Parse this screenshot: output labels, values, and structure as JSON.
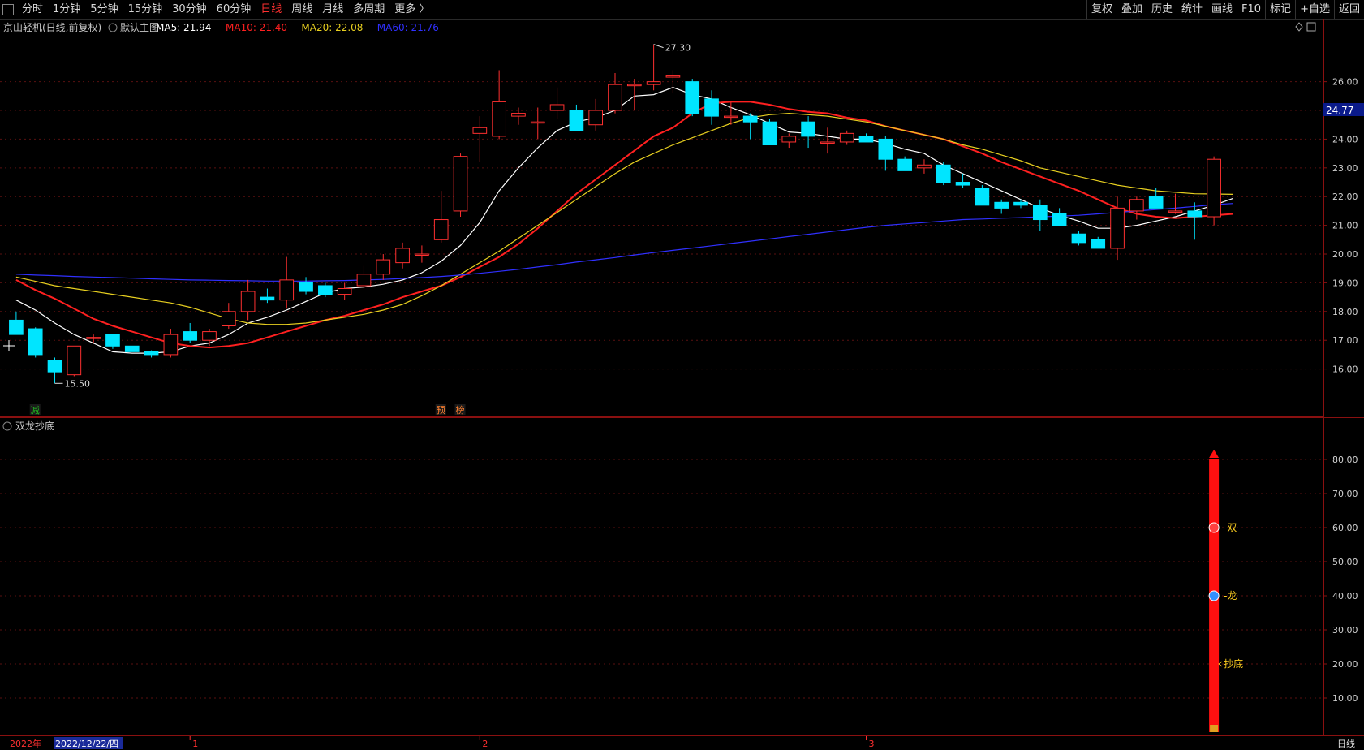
{
  "toolbar": {
    "periods": [
      "分时",
      "1分钟",
      "5分钟",
      "15分钟",
      "30分钟",
      "60分钟",
      "日线",
      "周线",
      "月线",
      "多周期",
      "更多 〉"
    ],
    "active_period": "日线",
    "tools": [
      "复权",
      "叠加",
      "历史",
      "统计",
      "画线",
      "F10",
      "标记",
      "+自选",
      "返回"
    ]
  },
  "main": {
    "stock_title": "京山轻机(日线,前复权)",
    "template_label": "默认主图",
    "ma": [
      {
        "label": "MA5: 21.94",
        "color": "#ffffff"
      },
      {
        "label": "MA10: 21.40",
        "color": "#ff2020"
      },
      {
        "label": "MA20: 22.08",
        "color": "#e8d020"
      },
      {
        "label": "MA60: 21.76",
        "color": "#3030ff"
      }
    ],
    "price_tag": "24.77",
    "high_label": "27.30",
    "low_label": "15.50",
    "markers": [
      {
        "text": "减",
        "color": "#20c020",
        "index": 1
      },
      {
        "text": "预",
        "color": "#ff8030",
        "index": 22
      },
      {
        "text": "榜",
        "color": "#ff8030",
        "index": 23
      }
    ]
  },
  "indicator": {
    "title": "双龙抄底",
    "labels": [
      {
        "text": "-双",
        "value": 60
      },
      {
        "text": "-龙",
        "value": 40
      },
      {
        "text": "抄底",
        "value": 20
      }
    ]
  },
  "axis": {
    "year_label": "2022年",
    "cursor_date": "2022/12/22/四",
    "months": [
      {
        "text": "1",
        "index": 9
      },
      {
        "text": "2",
        "index": 24
      },
      {
        "text": "3",
        "index": 44
      }
    ],
    "period_label": "日线"
  },
  "chart_data": {
    "type": "candlestick",
    "title": "京山轻机(日线,前复权)",
    "y_ticks": [
      16.0,
      17.0,
      18.0,
      19.0,
      20.0,
      21.0,
      22.0,
      23.0,
      24.0,
      25.0,
      26.0
    ],
    "ylim": [
      15.0,
      27.6
    ],
    "candles": [
      {
        "o": 17.7,
        "h": 18.0,
        "l": 17.2,
        "c": 17.2
      },
      {
        "o": 17.4,
        "h": 17.45,
        "l": 16.4,
        "c": 16.5
      },
      {
        "o": 16.3,
        "h": 16.4,
        "l": 15.5,
        "c": 15.9
      },
      {
        "o": 15.8,
        "h": 16.8,
        "l": 15.75,
        "c": 16.8
      },
      {
        "o": 17.1,
        "h": 17.2,
        "l": 16.9,
        "c": 17.1
      },
      {
        "o": 17.2,
        "h": 17.2,
        "l": 16.7,
        "c": 16.8
      },
      {
        "o": 16.8,
        "h": 16.8,
        "l": 16.6,
        "c": 16.6
      },
      {
        "o": 16.6,
        "h": 16.65,
        "l": 16.4,
        "c": 16.5
      },
      {
        "o": 16.5,
        "h": 17.4,
        "l": 16.4,
        "c": 17.2
      },
      {
        "o": 17.3,
        "h": 17.6,
        "l": 16.9,
        "c": 17.0
      },
      {
        "o": 17.0,
        "h": 17.4,
        "l": 16.8,
        "c": 17.3
      },
      {
        "o": 17.5,
        "h": 18.3,
        "l": 17.4,
        "c": 18.0
      },
      {
        "o": 18.0,
        "h": 19.1,
        "l": 17.7,
        "c": 18.7
      },
      {
        "o": 18.5,
        "h": 18.8,
        "l": 18.3,
        "c": 18.4
      },
      {
        "o": 18.4,
        "h": 19.9,
        "l": 18.1,
        "c": 19.1
      },
      {
        "o": 19.0,
        "h": 19.2,
        "l": 18.6,
        "c": 18.7
      },
      {
        "o": 18.9,
        "h": 19.0,
        "l": 18.5,
        "c": 18.6
      },
      {
        "o": 18.6,
        "h": 19.0,
        "l": 18.4,
        "c": 18.8
      },
      {
        "o": 18.9,
        "h": 19.6,
        "l": 18.8,
        "c": 19.3
      },
      {
        "o": 19.3,
        "h": 20.0,
        "l": 19.1,
        "c": 19.8
      },
      {
        "o": 19.7,
        "h": 20.4,
        "l": 19.5,
        "c": 20.2
      },
      {
        "o": 20.0,
        "h": 20.3,
        "l": 19.7,
        "c": 20.0
      },
      {
        "o": 20.5,
        "h": 22.2,
        "l": 20.4,
        "c": 21.2
      },
      {
        "o": 21.5,
        "h": 23.5,
        "l": 21.3,
        "c": 23.4
      },
      {
        "o": 24.2,
        "h": 24.8,
        "l": 23.2,
        "c": 24.4
      },
      {
        "o": 24.1,
        "h": 26.4,
        "l": 24.0,
        "c": 25.3
      },
      {
        "o": 24.8,
        "h": 25.1,
        "l": 24.5,
        "c": 24.9
      },
      {
        "o": 24.6,
        "h": 25.1,
        "l": 24.0,
        "c": 24.6
      },
      {
        "o": 25.0,
        "h": 25.8,
        "l": 24.7,
        "c": 25.2
      },
      {
        "o": 25.0,
        "h": 25.2,
        "l": 24.3,
        "c": 24.3
      },
      {
        "o": 24.5,
        "h": 25.4,
        "l": 24.3,
        "c": 25.0
      },
      {
        "o": 25.0,
        "h": 26.3,
        "l": 24.9,
        "c": 25.9
      },
      {
        "o": 25.9,
        "h": 26.1,
        "l": 25.0,
        "c": 25.9
      },
      {
        "o": 25.9,
        "h": 27.3,
        "l": 25.7,
        "c": 26.0
      },
      {
        "o": 26.2,
        "h": 26.4,
        "l": 25.6,
        "c": 26.2
      },
      {
        "o": 26.0,
        "h": 26.1,
        "l": 24.8,
        "c": 24.9
      },
      {
        "o": 25.4,
        "h": 25.7,
        "l": 24.5,
        "c": 24.8
      },
      {
        "o": 24.8,
        "h": 25.3,
        "l": 24.5,
        "c": 24.8
      },
      {
        "o": 24.8,
        "h": 24.9,
        "l": 24.0,
        "c": 24.6
      },
      {
        "o": 24.6,
        "h": 24.7,
        "l": 23.8,
        "c": 23.8
      },
      {
        "o": 23.9,
        "h": 24.2,
        "l": 23.7,
        "c": 24.1
      },
      {
        "o": 24.6,
        "h": 24.8,
        "l": 23.7,
        "c": 24.1
      },
      {
        "o": 23.9,
        "h": 24.4,
        "l": 23.5,
        "c": 23.9
      },
      {
        "o": 23.9,
        "h": 24.3,
        "l": 23.8,
        "c": 24.2
      },
      {
        "o": 24.1,
        "h": 24.2,
        "l": 23.9,
        "c": 23.9
      },
      {
        "o": 24.0,
        "h": 24.1,
        "l": 22.9,
        "c": 23.3
      },
      {
        "o": 23.3,
        "h": 23.4,
        "l": 22.9,
        "c": 22.9
      },
      {
        "o": 23.0,
        "h": 23.3,
        "l": 22.8,
        "c": 23.1
      },
      {
        "o": 23.1,
        "h": 23.2,
        "l": 22.4,
        "c": 22.5
      },
      {
        "o": 22.5,
        "h": 22.8,
        "l": 22.3,
        "c": 22.4
      },
      {
        "o": 22.3,
        "h": 22.4,
        "l": 21.7,
        "c": 21.7
      },
      {
        "o": 21.8,
        "h": 21.9,
        "l": 21.4,
        "c": 21.6
      },
      {
        "o": 21.8,
        "h": 21.9,
        "l": 21.6,
        "c": 21.7
      },
      {
        "o": 21.7,
        "h": 21.9,
        "l": 20.8,
        "c": 21.2
      },
      {
        "o": 21.4,
        "h": 21.6,
        "l": 21.0,
        "c": 21.0
      },
      {
        "o": 20.7,
        "h": 20.8,
        "l": 20.3,
        "c": 20.4
      },
      {
        "o": 20.5,
        "h": 20.6,
        "l": 20.2,
        "c": 20.2
      },
      {
        "o": 20.2,
        "h": 22.0,
        "l": 19.8,
        "c": 21.6
      },
      {
        "o": 21.5,
        "h": 22.0,
        "l": 21.2,
        "c": 21.9
      },
      {
        "o": 22.0,
        "h": 22.3,
        "l": 21.6,
        "c": 21.6
      },
      {
        "o": 21.5,
        "h": 22.1,
        "l": 21.4,
        "c": 21.5
      },
      {
        "o": 21.5,
        "h": 21.8,
        "l": 20.5,
        "c": 21.3
      },
      {
        "o": 21.3,
        "h": 23.4,
        "l": 21.0,
        "c": 23.3
      }
    ],
    "series": [
      {
        "name": "MA5",
        "color": "#ffffff",
        "values": [
          18.4,
          18.05,
          17.6,
          17.2,
          16.9,
          16.6,
          16.55,
          16.55,
          16.6,
          16.8,
          16.9,
          17.2,
          17.6,
          17.8,
          18.05,
          18.35,
          18.65,
          18.8,
          18.85,
          18.95,
          19.1,
          19.35,
          19.75,
          20.3,
          21.1,
          22.2,
          23.0,
          23.7,
          24.3,
          24.6,
          24.75,
          25.0,
          25.5,
          25.55,
          25.8,
          25.55,
          25.4,
          25.1,
          24.85,
          24.55,
          24.25,
          24.2,
          24.1,
          24.0,
          24.0,
          23.85,
          23.65,
          23.5,
          23.1,
          22.8,
          22.5,
          22.2,
          21.9,
          21.6,
          21.35,
          21.15,
          20.9,
          20.9,
          21.0,
          21.15,
          21.3,
          21.5,
          21.7,
          21.94
        ]
      },
      {
        "name": "MA10",
        "color": "#ff2020",
        "values": [
          19.1,
          18.75,
          18.45,
          18.1,
          17.75,
          17.5,
          17.3,
          17.1,
          16.9,
          16.8,
          16.75,
          16.8,
          16.9,
          17.1,
          17.3,
          17.5,
          17.7,
          17.85,
          18.05,
          18.25,
          18.5,
          18.7,
          18.9,
          19.2,
          19.55,
          19.9,
          20.35,
          20.9,
          21.5,
          22.1,
          22.6,
          23.1,
          23.6,
          24.1,
          24.4,
          24.9,
          25.25,
          25.3,
          25.3,
          25.2,
          25.05,
          24.95,
          24.9,
          24.75,
          24.65,
          24.45,
          24.3,
          24.15,
          24.0,
          23.75,
          23.5,
          23.2,
          22.95,
          22.7,
          22.45,
          22.2,
          21.9,
          21.6,
          21.4,
          21.3,
          21.25,
          21.3,
          21.35,
          21.4
        ]
      },
      {
        "name": "MA20",
        "color": "#e8d020",
        "values": [
          19.2,
          19.05,
          18.9,
          18.8,
          18.7,
          18.6,
          18.5,
          18.4,
          18.3,
          18.15,
          17.95,
          17.75,
          17.6,
          17.55,
          17.55,
          17.6,
          17.7,
          17.8,
          17.9,
          18.05,
          18.25,
          18.55,
          18.9,
          19.3,
          19.7,
          20.1,
          20.55,
          21.0,
          21.45,
          21.9,
          22.35,
          22.8,
          23.2,
          23.5,
          23.8,
          24.05,
          24.3,
          24.55,
          24.75,
          24.85,
          24.9,
          24.85,
          24.8,
          24.7,
          24.6,
          24.45,
          24.3,
          24.15,
          24.0,
          23.8,
          23.65,
          23.45,
          23.25,
          23.0,
          22.85,
          22.7,
          22.55,
          22.4,
          22.3,
          22.2,
          22.15,
          22.1,
          22.09,
          22.08
        ]
      },
      {
        "name": "MA60",
        "color": "#3030ff",
        "values": [
          19.3,
          19.27,
          19.25,
          19.22,
          19.2,
          19.18,
          19.16,
          19.14,
          19.12,
          19.1,
          19.09,
          19.08,
          19.07,
          19.06,
          19.06,
          19.06,
          19.07,
          19.08,
          19.1,
          19.12,
          19.15,
          19.18,
          19.22,
          19.27,
          19.33,
          19.4,
          19.47,
          19.55,
          19.63,
          19.72,
          19.8,
          19.88,
          19.97,
          20.05,
          20.13,
          20.21,
          20.29,
          20.37,
          20.45,
          20.53,
          20.61,
          20.69,
          20.77,
          20.85,
          20.93,
          21.0,
          21.05,
          21.1,
          21.15,
          21.2,
          21.22,
          21.25,
          21.27,
          21.3,
          21.32,
          21.35,
          21.4,
          21.45,
          21.5,
          21.55,
          21.6,
          21.66,
          21.72,
          21.76
        ]
      }
    ],
    "indicator": {
      "name": "双龙抄底",
      "y_ticks": [
        10.0,
        20.0,
        30.0,
        40.0,
        50.0,
        60.0,
        70.0,
        80.0
      ],
      "ylim": [
        0,
        90
      ],
      "bar_index": 62,
      "bar_top": 80,
      "bar_bottom": 0,
      "bar_color": "#ff1010"
    }
  }
}
